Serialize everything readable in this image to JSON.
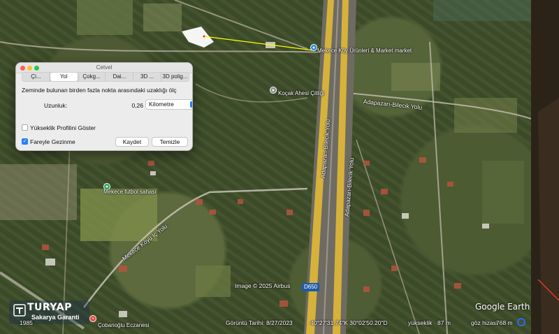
{
  "window": {
    "title": "Cetvel"
  },
  "tabs": [
    {
      "label": "Çi...",
      "active": false
    },
    {
      "label": "Yol",
      "active": true
    },
    {
      "label": "Çokg...",
      "active": false
    },
    {
      "label": "Dai...",
      "active": false
    },
    {
      "label": "3D ...",
      "active": false
    },
    {
      "label": "3D polig...",
      "active": false
    }
  ],
  "ruler": {
    "description": "Zeminde bulunan birden fazla nokta arasındaki uzaklığı ölç",
    "length_label": "Uzunluk:",
    "length_value": "0,26",
    "unit": "Kilometre",
    "show_elevation_profile": {
      "label": "Yükseklik Profilini Göster",
      "checked": false
    },
    "mouse_navigation": {
      "label": "Fareyle Gezinme",
      "checked": true
    },
    "save_label": "Kaydet",
    "clear_label": "Temizle"
  },
  "map_labels": {
    "market": "Mekece Köy Ürünleri & Market market",
    "kocak": "Koçak Ahesi Çitliği",
    "football": "Mekece futbol sahası",
    "eczane": "Çobanoğlu Eczanesi",
    "road_bilecik": "Adapazarı-Bilecik Yolu",
    "road_bilecik2": "Adapazarı-Bilecik Yolu",
    "road_mekece": "Mekece Köyü İç Yolu",
    "road_bilecik3": "Adapazarı-Bilecik Yolu",
    "road_number": "D650",
    "copyright": "Image © 2025 Airbus",
    "google_earth": "Google Earth",
    "top_right": ""
  },
  "status": {
    "capture_date": "Görüntü Tarihi: 8/27/2023",
    "coordinates": "40°27'31.74\"K   30°02'50.20\"D",
    "elevation_label": "yükseklik",
    "elevation_value": "87 m",
    "eye_altitude_label": "göz hizası",
    "eye_altitude_value": "768 m",
    "year": "1985"
  },
  "watermark": {
    "brand": "TURYAP",
    "subtitle": "Sakarya Garanti"
  },
  "colors": {
    "highway": "#d6b23a",
    "measure_line": "#ffff00",
    "accent": "#2a7ef7"
  },
  "icons": [
    "close-light",
    "minimize-light",
    "zoom-light",
    "chevron-updown-icon",
    "checkmark-icon",
    "poi-pin-icon",
    "compass-icon"
  ]
}
